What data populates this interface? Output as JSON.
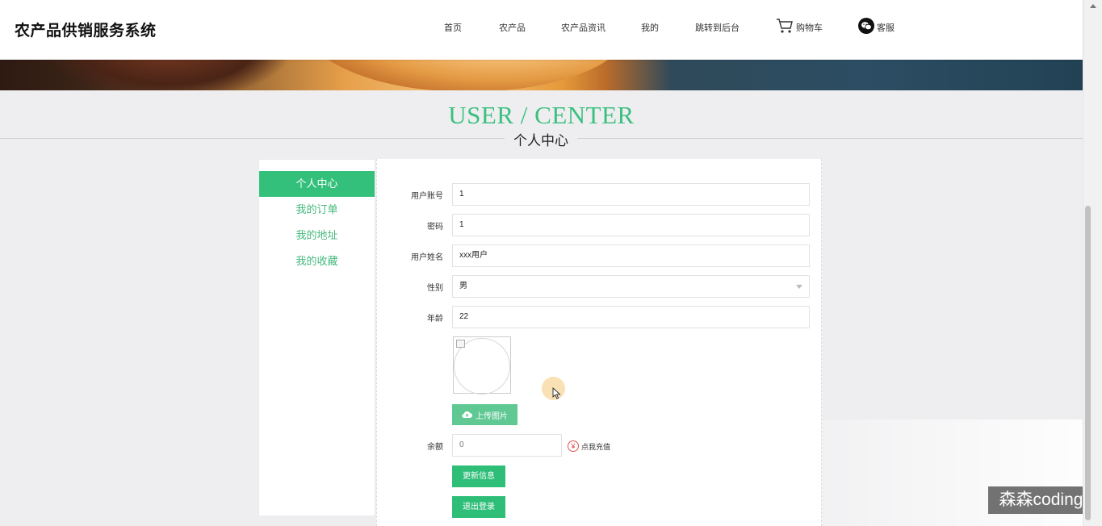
{
  "header": {
    "brand": "农产品供销服务系统",
    "nav": {
      "home": "首页",
      "products": "农产品",
      "news": "农产品资讯",
      "mine": "我的",
      "admin": "跳转到后台",
      "cart": "购物车",
      "service": "客服"
    }
  },
  "title": {
    "en": "USER / CENTER",
    "zh": "个人中心"
  },
  "sidebar": {
    "items": [
      {
        "label": "个人中心",
        "active": true
      },
      {
        "label": "我的订单",
        "active": false
      },
      {
        "label": "我的地址",
        "active": false
      },
      {
        "label": "我的收藏",
        "active": false
      }
    ]
  },
  "form": {
    "account": {
      "label": "用户账号",
      "value": "1"
    },
    "password": {
      "label": "密码",
      "value": "1"
    },
    "name": {
      "label": "用户姓名",
      "value": "xxx用户"
    },
    "gender": {
      "label": "性别",
      "value": "男"
    },
    "age": {
      "label": "年龄",
      "value": "22"
    },
    "upload_label": "上传图片",
    "balance": {
      "label": "余额",
      "value": "0"
    },
    "recharge_label": "点我充值",
    "update_label": "更新信息",
    "logout_label": "退出登录"
  },
  "watermark": "森森coding",
  "colors": {
    "accent": "#33c07b",
    "title": "#3cc07f"
  }
}
